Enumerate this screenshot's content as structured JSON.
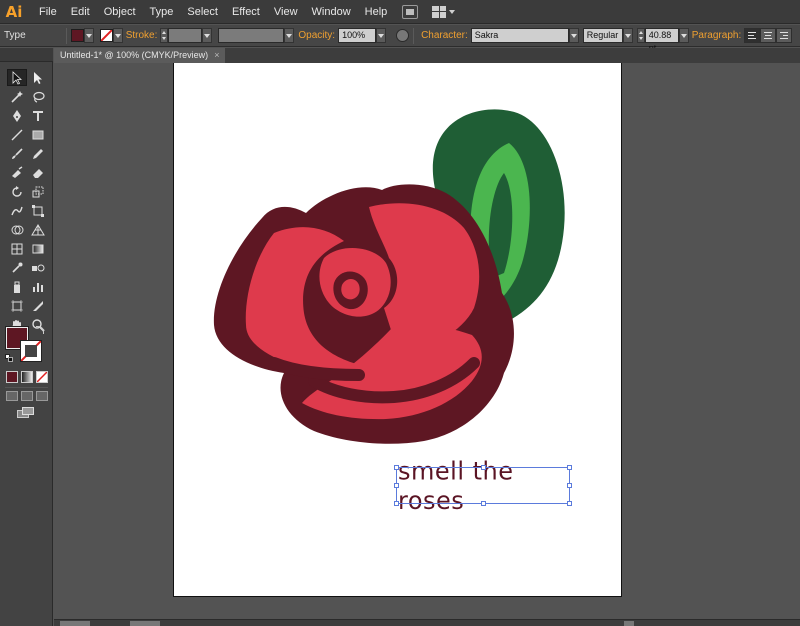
{
  "app": {
    "logo": "Ai"
  },
  "menu": [
    "File",
    "Edit",
    "Object",
    "Type",
    "Select",
    "Effect",
    "View",
    "Window",
    "Help"
  ],
  "control_bar": {
    "tool_name": "Type",
    "fill_color": "#5e1723",
    "stroke_label": "Stroke:",
    "opacity_label": "Opacity:",
    "opacity_value": "100%",
    "character_label": "Character:",
    "font_family": "Sakra",
    "font_style": "Regular",
    "font_size": "40.88 pt",
    "paragraph_label": "Paragraph:"
  },
  "document": {
    "tab_title": "Untitled-1* @ 100% (CMYK/Preview)",
    "close_glyph": "×"
  },
  "artwork": {
    "text": "smell the roses",
    "colors": {
      "rose_outline": "#5e1723",
      "petal": "#de3a4c",
      "leaf_dark": "#1f5e35",
      "leaf_light": "#4bb64f",
      "text": "#5a1424",
      "selection": "#5b7bdc"
    }
  },
  "toolbox": {
    "fill_swatch": "#5e1723"
  }
}
